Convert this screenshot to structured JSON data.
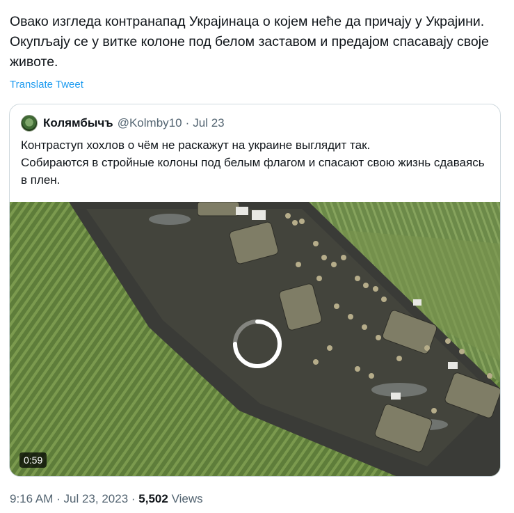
{
  "tweet": {
    "text": "Овако изгледа контранапад Украјинаца о којем неће да причају у Украјини. Окупљају се у витке колоне под белом заставом и предајом спасавају своје животе.",
    "translate_label": "Translate Tweet"
  },
  "quote": {
    "author_name": "Колямбычъ",
    "handle": "@Kolmby10",
    "separator": "·",
    "date": "Jul 23",
    "text": "Контраступ хохлов о чём не раскажут на украине выглядит так.\nСобираются в стройные колоны под белым флагом и спасают свою жизнь сдаваясь в плен.",
    "video": {
      "duration": "0:59",
      "icon": "loading-spinner-icon"
    }
  },
  "meta": {
    "time": "9:16 AM",
    "separator1": "·",
    "date": "Jul 23, 2023",
    "separator2": "·",
    "views_count": "5,502",
    "views_label": "Views"
  },
  "colors": {
    "link": "#1d9bf0",
    "secondary_text": "#536471",
    "border": "#cfd9de"
  }
}
